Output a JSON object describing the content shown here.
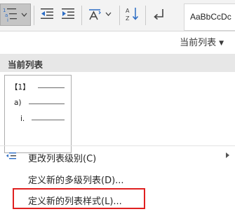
{
  "ribbon": {
    "buttons": [
      {
        "name": "multilevel-list",
        "icon": "multilevel-list-icon"
      },
      {
        "name": "decrease-indent",
        "icon": "decrease-indent-icon"
      },
      {
        "name": "increase-indent",
        "icon": "increase-indent-icon"
      },
      {
        "name": "chinese-layout",
        "icon": "chinese-layout-icon"
      },
      {
        "name": "sort",
        "icon": "sort-icon"
      },
      {
        "name": "show-hide-marks",
        "icon": "paragraph-mark-icon"
      }
    ],
    "style_preview": "AaBbCcDc"
  },
  "dropdown": {
    "filter_label": "当前列表",
    "section_header": "当前列表",
    "list_levels": [
      "【1】",
      "a)",
      "i."
    ],
    "menu": [
      {
        "label": "更改列表级别(C)",
        "icon": "change-list-level-icon",
        "has_submenu": true
      },
      {
        "label": "定义新的多级列表(D)...",
        "icon": "",
        "has_submenu": false
      },
      {
        "label": "定义新的列表样式(L)...",
        "icon": "",
        "has_submenu": false,
        "highlighted": true
      }
    ]
  },
  "colors": {
    "highlight_border": "#e02020",
    "ribbon_bg": "#f3f3f3",
    "section_header_bg": "#e7e7e7",
    "icon_blue": "#2b6cc4"
  }
}
